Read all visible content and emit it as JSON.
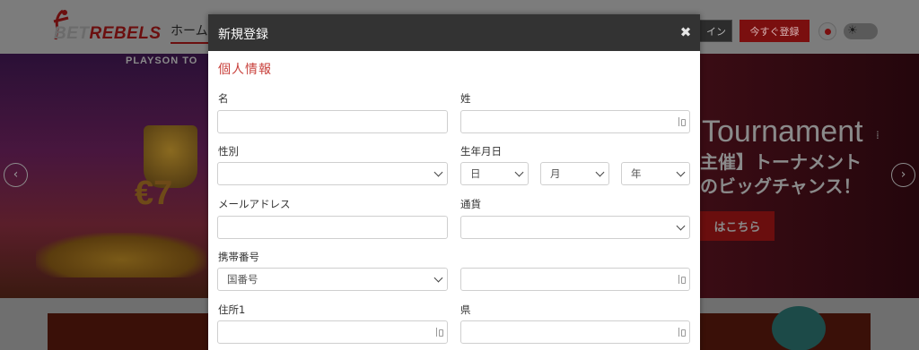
{
  "site": {
    "logo_text_a": "BET",
    "logo_text_b": "REBELS",
    "nav_home": "ホーム",
    "login_partial": "イン",
    "register_button": "今すぐ登録",
    "theme_icon": "sun-icon"
  },
  "hero": {
    "provider": "PLAYSON TO",
    "promo_partial": "€7",
    "tournament_title": "Tournament",
    "promo_line1": "主催】トーナメント",
    "promo_line2": "のビッグチャンス！",
    "cta_partial": "はこちら"
  },
  "modal": {
    "title": "新規登録",
    "close_icon": "close-icon",
    "section_title": "個人情報",
    "fields": {
      "first_name_label": "名",
      "last_name_label": "姓",
      "gender_label": "性別",
      "dob_label": "生年月日",
      "day_option": "日",
      "month_option": "月",
      "year_option": "年",
      "email_label": "メールアドレス",
      "currency_label": "通貨",
      "mobile_label": "携帯番号",
      "country_code_option": "国番号",
      "address1_label": "住所1",
      "prefecture_label": "県"
    }
  },
  "colors": {
    "accent_red": "#c8413c",
    "header_dark": "#333333"
  }
}
